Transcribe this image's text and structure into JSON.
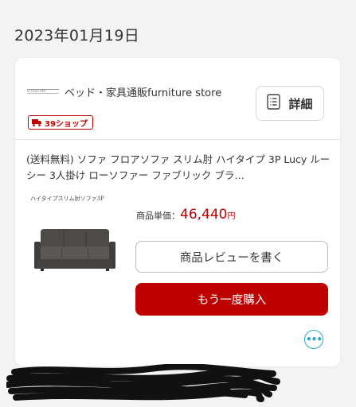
{
  "order": {
    "date": "2023年01月19日"
  },
  "store": {
    "logo_text": "STOREFONT",
    "name": "ベッド・家具通販furniture store",
    "badge_label": "39ショップ",
    "detail_button_label": "詳細"
  },
  "product": {
    "title": "(送料無料) ソファ フロアソファ スリム肘 ハイタイプ 3P Lucy ルーシー 3人掛け ローソファー ファブリック ブラ…",
    "sub_name": "ハイタイプスリム肘ソファ3P",
    "price_label": "商品単価：",
    "price_value": "46,440",
    "price_unit": "円"
  },
  "actions": {
    "review_label": "商品レビューを書く",
    "rebuy_label": "もう一度購入",
    "more_label": "•••"
  },
  "colors": {
    "accent_red": "#bf0000",
    "accent_teal": "#2aa8c7"
  },
  "icons": {
    "badge": "truck-icon",
    "detail": "document-list-icon",
    "more": "more-dots-icon"
  }
}
